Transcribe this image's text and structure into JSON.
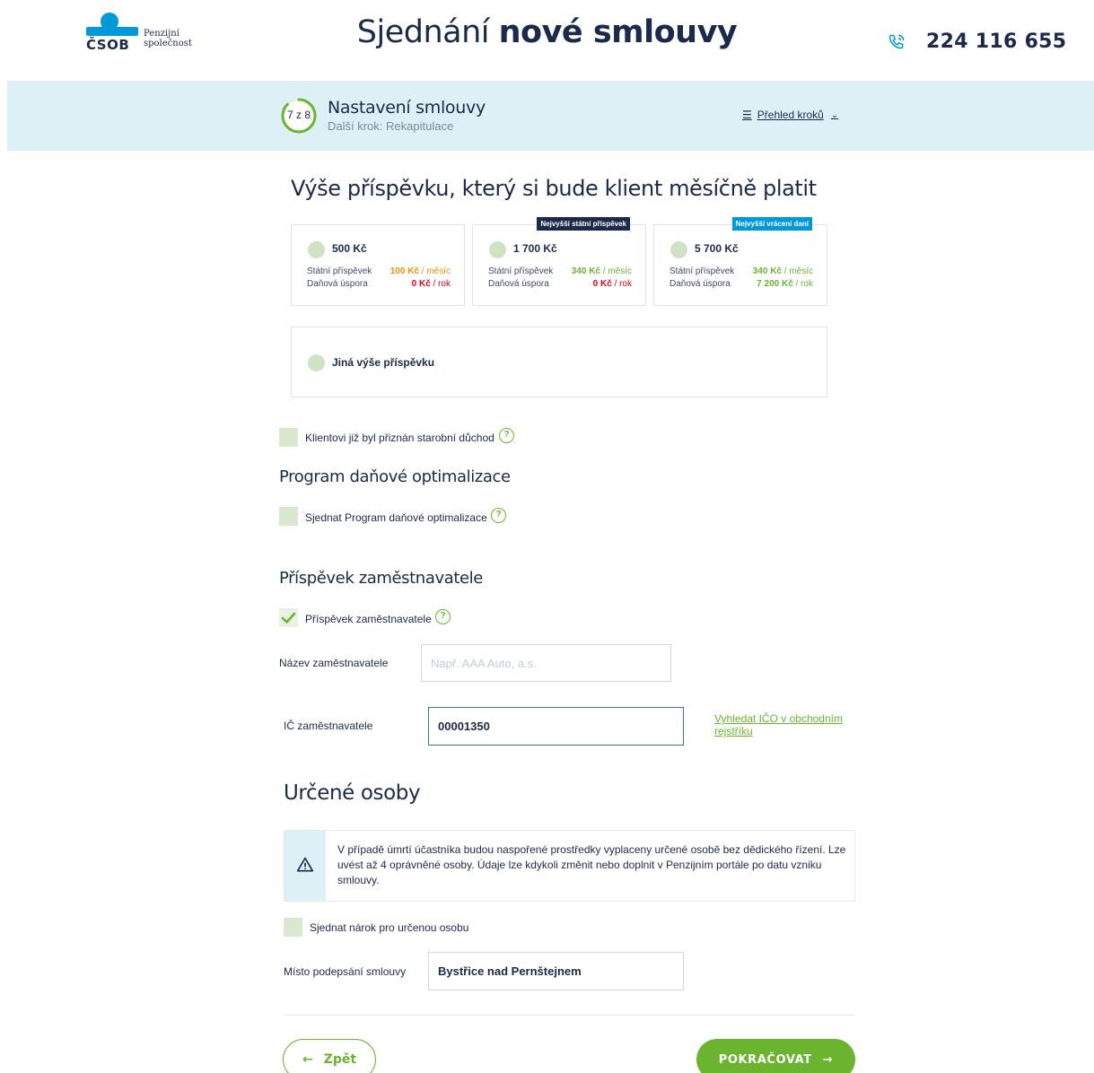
{
  "header": {
    "logo_text": "ČSOB",
    "logo_sub": "Penzijní společnost",
    "title_regular": "Sjednání ",
    "title_bold": "nové smlouvy",
    "phone": "224 116 655"
  },
  "stepper": {
    "count": "7 z 8",
    "progress": 0.875,
    "title": "Nastavení smlouvy",
    "next": "Další krok: Rekapitulace",
    "overview_label": "Přehled kroků"
  },
  "contribution": {
    "heading": "Výše příspěvku, který si bude klient měsíčně platit",
    "state_label": "Státní příspěvek",
    "tax_label": "Daňová úspora",
    "options": [
      {
        "amount": "500 Kč",
        "state_value": "100 Kč",
        "state_unit": " / měsíc",
        "tax_value": "0 Kč",
        "tax_unit": " / rok",
        "badge": ""
      },
      {
        "amount": "1 700 Kč",
        "state_value": "340 Kč",
        "state_unit": " / měsíc",
        "tax_value": "0 Kč",
        "tax_unit": " / rok",
        "badge": "Nejvyšší státní příspěvek"
      },
      {
        "amount": "5 700 Kč",
        "state_value": "340 Kč",
        "state_unit": " / měsíc",
        "tax_value": "7 200 Kč",
        "tax_unit": " / rok",
        "badge": "Nejvyšší vrácení daní"
      }
    ],
    "other_label": "Jiná výše příspěvku",
    "badge_colors": [
      "#1b2a4a",
      "#0099d8"
    ]
  },
  "pension_checkbox": {
    "label": "Klientovi již byl přiznán starobní důchod",
    "checked": false
  },
  "tax_program": {
    "heading": "Program daňové optimalizace",
    "checkbox_label": "Sjednat Program daňové optimalizace",
    "checked": false
  },
  "employer": {
    "heading": "Příspěvek zaměstnavatele",
    "checkbox_label": "Příspěvek zaměstnavatele",
    "checked": true,
    "name_label": "Název zaměstnavatele",
    "name_placeholder": "Např. AAA Auto, a.s.",
    "ico_label": "IČ zaměstnavatele",
    "ico_value": "00001350",
    "search_link": "Vyhledat IČO v obchodním rejstříku"
  },
  "persons": {
    "heading": "Určené osoby",
    "notice": "V případě úmrtí účastníka budou naspořené prostředky vyplaceny určené osobě bez dědického řízení. Lze uvést až 4 oprávněné osoby. Údaje lze kdykoli změnit nebo doplnit v Penzijním portále po datu vzniku smlouvy.",
    "checkbox_label": "Sjednat nárok pro určenou osobu",
    "checked": false,
    "place_label": "Místo podepsání smlouvy",
    "place_value": "Bystřice nad Pernštejnem"
  },
  "nav": {
    "back": "Zpět",
    "next": "POKRAČOVAT"
  },
  "colors": {
    "accent": "#6bb42f",
    "brand": "#0099d8",
    "navy": "#1b2a4a",
    "orange": "#f39200",
    "red": "#e2001a"
  }
}
